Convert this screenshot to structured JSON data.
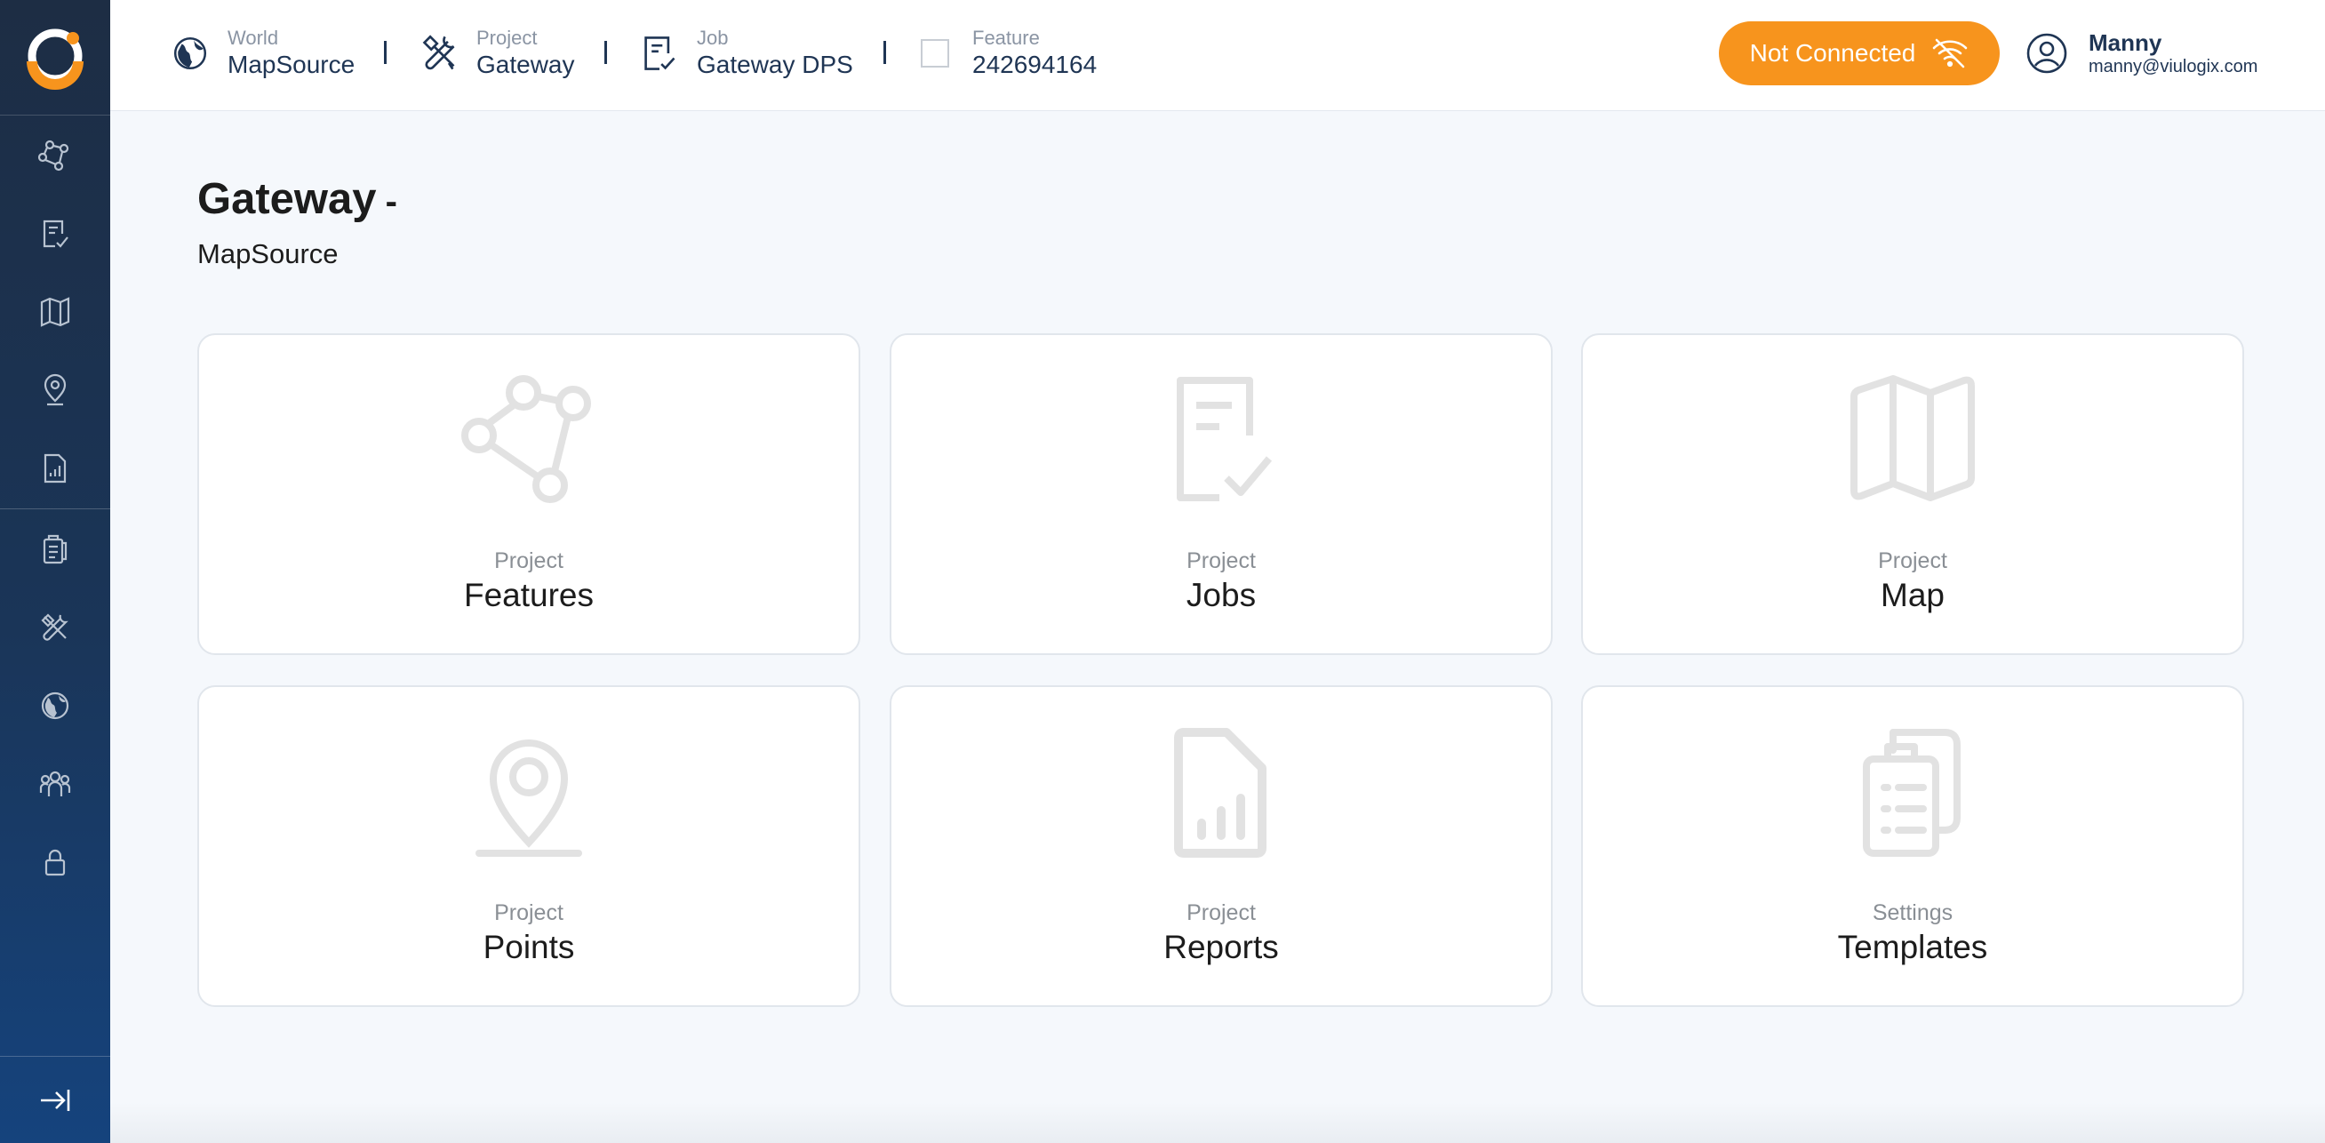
{
  "breadcrumb": {
    "world": {
      "label": "World",
      "value": "MapSource"
    },
    "project": {
      "label": "Project",
      "value": "Gateway"
    },
    "job": {
      "label": "Job",
      "value": "Gateway DPS"
    },
    "feature": {
      "label": "Feature",
      "value": "242694164"
    }
  },
  "status": {
    "label": "Not Connected",
    "icon": "wifi-off-icon",
    "color": "#f7941d"
  },
  "user": {
    "name": "Manny",
    "email": "manny@viulogix.com"
  },
  "page": {
    "title": "Gateway",
    "title_dash": "-",
    "subtitle": "MapSource"
  },
  "cards": [
    {
      "label": "Project",
      "value": "Features",
      "icon": "features-nodes-icon"
    },
    {
      "label": "Project",
      "value": "Jobs",
      "icon": "jobs-checklist-icon"
    },
    {
      "label": "Project",
      "value": "Map",
      "icon": "map-icon"
    },
    {
      "label": "Project",
      "value": "Points",
      "icon": "map-pin-icon"
    },
    {
      "label": "Project",
      "value": "Reports",
      "icon": "report-chart-icon"
    },
    {
      "label": "Settings",
      "value": "Templates",
      "icon": "clipboard-list-icon"
    }
  ],
  "sidebar": {
    "items": [
      {
        "icon": "features-nodes-icon"
      },
      {
        "icon": "jobs-checklist-icon"
      },
      {
        "icon": "map-icon"
      },
      {
        "icon": "map-pin-icon"
      },
      {
        "icon": "report-chart-icon"
      },
      {
        "icon": "clipboard-list-icon"
      },
      {
        "icon": "tools-icon"
      },
      {
        "icon": "globe-icon"
      },
      {
        "icon": "users-icon"
      },
      {
        "icon": "lock-icon"
      }
    ],
    "collapse_icon": "expand-sidebar-icon"
  },
  "colors": {
    "accent": "#f7941d",
    "sidebar": "#1a3558",
    "text_dark": "#1f3554"
  }
}
